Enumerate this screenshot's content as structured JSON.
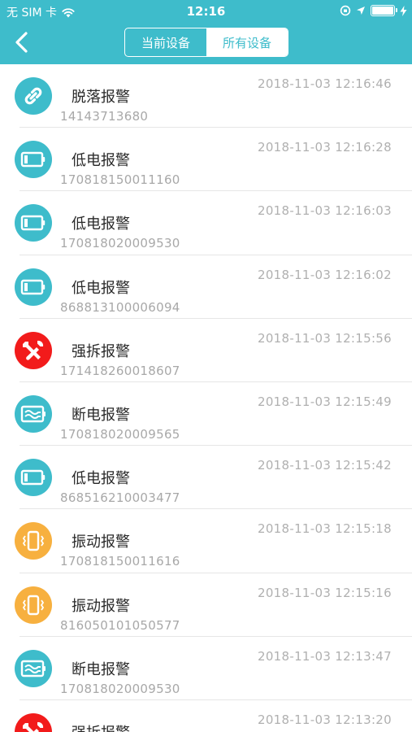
{
  "status": {
    "carrier": "无 SIM 卡",
    "time": "12:16"
  },
  "header": {
    "tabs": [
      "当前设备",
      "所有设备"
    ],
    "active_tab": "所有设备"
  },
  "colors": {
    "accent": "#3ebccb",
    "red": "#f21b1b",
    "orange": "#f7b03f"
  },
  "alerts": [
    {
      "type": "脱落报警",
      "icon": "link-icon",
      "device": "14143713680",
      "time": "2018-11-03 12:16:46"
    },
    {
      "type": "低电报警",
      "icon": "low-battery-icon",
      "device": "170818150011160",
      "time": "2018-11-03 12:16:28"
    },
    {
      "type": "低电报警",
      "icon": "low-battery-icon",
      "device": "170818020009530",
      "time": "2018-11-03 12:16:03"
    },
    {
      "type": "低电报警",
      "icon": "low-battery-icon",
      "device": "868813100006094",
      "time": "2018-11-03 12:16:02"
    },
    {
      "type": "强拆报警",
      "icon": "tools-icon",
      "device": "171418260018607",
      "time": "2018-11-03 12:15:56"
    },
    {
      "type": "断电报警",
      "icon": "power-off-icon",
      "device": "170818020009565",
      "time": "2018-11-03 12:15:49"
    },
    {
      "type": "低电报警",
      "icon": "low-battery-icon",
      "device": "868516210003477",
      "time": "2018-11-03 12:15:42"
    },
    {
      "type": "振动报警",
      "icon": "vibration-icon",
      "device": "170818150011616",
      "time": "2018-11-03 12:15:18"
    },
    {
      "type": "振动报警",
      "icon": "vibration-icon",
      "device": "816050101050577",
      "time": "2018-11-03 12:15:16"
    },
    {
      "type": "断电报警",
      "icon": "power-off-icon",
      "device": "170818020009530",
      "time": "2018-11-03 12:13:47"
    },
    {
      "type": "强拆报警",
      "icon": "tools-icon",
      "device": "",
      "time": "2018-11-03 12:13:20"
    }
  ]
}
